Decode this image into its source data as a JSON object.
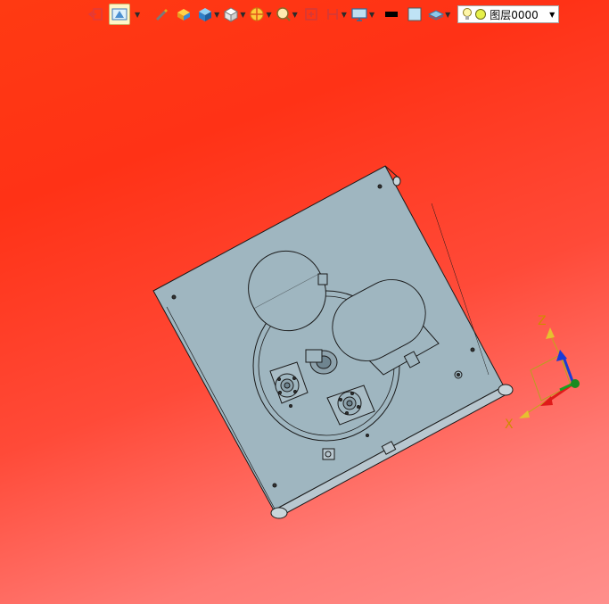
{
  "toolbar": {
    "buttons": [
      {
        "name": "exit-sketch-icon"
      },
      {
        "name": "render-style-icon",
        "active": true
      },
      {
        "name": "pen-icon"
      },
      {
        "name": "box-solid-icon"
      },
      {
        "name": "cube-blue-icon"
      },
      {
        "name": "cube-white-icon"
      },
      {
        "name": "section-view-icon"
      },
      {
        "name": "zoom-icon"
      },
      {
        "name": "fit-view-icon"
      },
      {
        "name": "ortho-view-icon"
      },
      {
        "name": "display-icon"
      },
      {
        "name": "line-color-swatch",
        "color": "#000000"
      },
      {
        "name": "fill-color-swatch",
        "color": "#bfe3f5"
      },
      {
        "name": "layer-icon"
      }
    ],
    "layer": {
      "label": "图层0000"
    }
  },
  "colors": {
    "part_fill": "#9fb6c0",
    "part_stroke": "#1a1a1a",
    "bg_top": "#ff3a12",
    "bg_bottom": "#ff8f8c"
  },
  "triad": {
    "x_label": "X",
    "y_label": "",
    "z_label": "Z"
  }
}
